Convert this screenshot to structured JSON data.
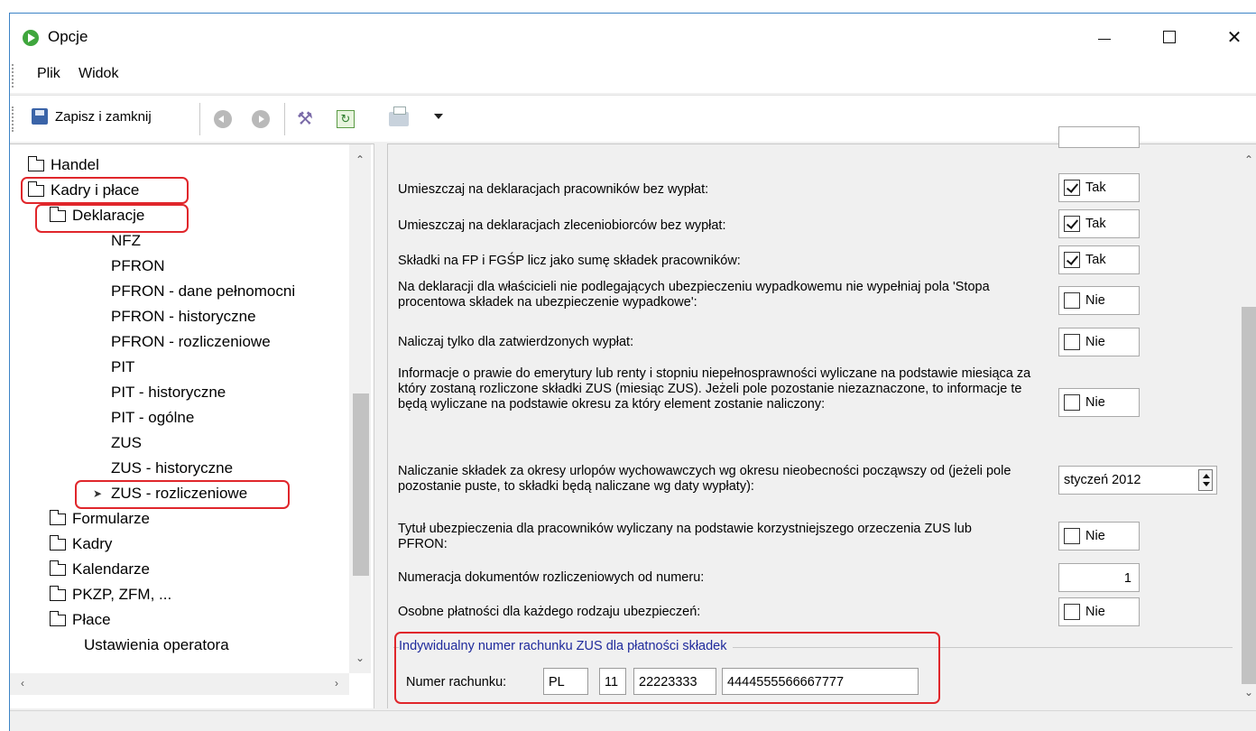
{
  "window": {
    "title": "Opcje",
    "minimize": "—",
    "maximize": "☐",
    "close": "✕"
  },
  "menu": {
    "items": [
      "Plik",
      "Widok"
    ]
  },
  "toolbar": {
    "save_label": "Zapisz i zamknij",
    "icons": [
      "save-icon",
      "back-icon",
      "forward-icon",
      "tools-icon",
      "refresh-icon",
      "print-icon",
      "dropdown-arrow-icon"
    ]
  },
  "tree": {
    "items": [
      {
        "label": "Handel",
        "type": "folder",
        "level": 0
      },
      {
        "label": "Kadry i płace",
        "type": "folder-open",
        "level": 0
      },
      {
        "label": "Deklaracje",
        "type": "folder-open",
        "level": 1
      },
      {
        "label": "NFZ",
        "type": "leaf",
        "level": 2
      },
      {
        "label": "PFRON",
        "type": "leaf",
        "level": 2
      },
      {
        "label": "PFRON - dane pełnomocni",
        "type": "leaf",
        "level": 2
      },
      {
        "label": "PFRON - historyczne",
        "type": "leaf",
        "level": 2
      },
      {
        "label": "PFRON - rozliczeniowe",
        "type": "leaf",
        "level": 2
      },
      {
        "label": "PIT",
        "type": "leaf",
        "level": 2
      },
      {
        "label": "PIT - historyczne",
        "type": "leaf",
        "level": 2
      },
      {
        "label": "PIT - ogólne",
        "type": "leaf",
        "level": 2
      },
      {
        "label": "ZUS",
        "type": "leaf",
        "level": 2
      },
      {
        "label": "ZUS - historyczne",
        "type": "leaf",
        "level": 2
      },
      {
        "label": "ZUS - rozliczeniowe",
        "type": "leaf-selected",
        "level": 2
      },
      {
        "label": "Formularze",
        "type": "folder",
        "level": 1
      },
      {
        "label": "Kadry",
        "type": "folder",
        "level": 1
      },
      {
        "label": "Kalendarze",
        "type": "folder",
        "level": 1
      },
      {
        "label": "PKZP, ZFM, ...",
        "type": "folder",
        "level": 1
      },
      {
        "label": "Płace",
        "type": "folder",
        "level": 1
      },
      {
        "label": "Ustawienia operatora",
        "type": "leaf",
        "level": 1
      }
    ]
  },
  "options": {
    "opt1": {
      "label": "Umieszczaj na deklaracjach pracowników bez wypłat:",
      "value": "Tak",
      "checked": true
    },
    "opt2": {
      "label": "Umieszczaj na deklaracjach zleceniobiorców bez wypłat:",
      "value": "Tak",
      "checked": true
    },
    "opt3": {
      "label": "Składki na FP i FGŚP licz jako sumę składek pracowników:",
      "value": "Tak",
      "checked": true
    },
    "opt4": {
      "label": "Na deklaracji dla właścicieli nie podlegających ubezpieczeniu wypadkowemu nie wypełniaj pola 'Stopa procentowa składek na ubezpieczenie wypadkowe':",
      "value": "Nie",
      "checked": false
    },
    "opt5": {
      "label": "Naliczaj tylko dla zatwierdzonych wypłat:",
      "value": "Nie",
      "checked": false
    },
    "opt6": {
      "label": "Informacje o prawie do emerytury lub renty i stopniu niepełnosprawności wyliczane na podstawie miesiąca za który zostaną rozliczone składki ZUS (miesiąc ZUS). Jeżeli pole pozostanie niezaznaczone, to informacje te będą wyliczane na podstawie okresu za który element zostanie naliczony:",
      "value": "Nie",
      "checked": false
    },
    "opt7": {
      "label": "Naliczanie składek za okresy urlopów wychowawczych wg okresu nieobecności począwszy od (jeżeli pole pozostanie puste, to składki będą naliczane wg daty wypłaty):",
      "value": "styczeń 2012"
    },
    "opt8": {
      "label": "Tytuł ubezpieczenia dla pracowników wyliczany na podstawie korzystniejszego orzeczenia ZUS lub PFRON:",
      "value": "Nie",
      "checked": false
    },
    "opt9": {
      "label": "Numeracja dokumentów rozliczeniowych od numeru:",
      "value": "1"
    },
    "opt10": {
      "label": "Osobne płatności dla każdego rodzaju ubezpieczeń:",
      "value": "Nie",
      "checked": false
    }
  },
  "account_group": {
    "title": "Indywidualny numer rachunku ZUS dla płatności składek",
    "label": "Numer rachunku:",
    "country": "PL",
    "check_digits": "11",
    "bank_code": "22223333",
    "account": "4444555566667777"
  },
  "highlight_color": "#e0262b",
  "group_title_color": "#1f2a9c"
}
